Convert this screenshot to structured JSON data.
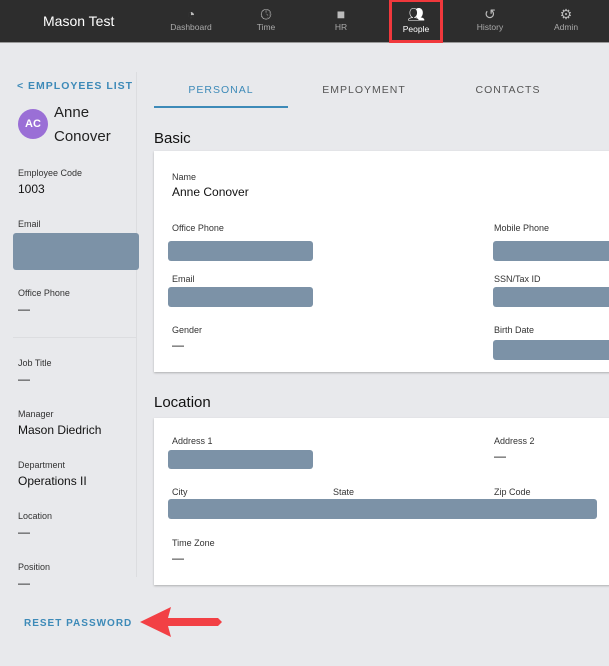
{
  "header": {
    "brand": "Mason Test",
    "nav": [
      {
        "label": "Dashboard",
        "icon": "dashboard-icon"
      },
      {
        "label": "Time",
        "icon": "clock-icon"
      },
      {
        "label": "HR",
        "icon": "folder-icon"
      },
      {
        "label": "People",
        "icon": "people-icon",
        "active": true
      },
      {
        "label": "History",
        "icon": "history-icon"
      },
      {
        "label": "Admin",
        "icon": "gear-icon"
      }
    ]
  },
  "sidebar": {
    "back": "< EMPLOYEES LIST",
    "initials": "AC",
    "first": "Anne",
    "last": "Conover",
    "employee_code_label": "Employee Code",
    "employee_code": "1003",
    "email_label": "Email",
    "office_phone_label": "Office Phone",
    "office_phone": "—",
    "job_title_label": "Job Title",
    "job_title": "—",
    "manager_label": "Manager",
    "manager": "Mason Diedrich",
    "department_label": "Department",
    "department": "Operations II",
    "location_label": "Location",
    "location": "—",
    "position_label": "Position",
    "position": "—",
    "reset": "RESET PASSWORD"
  },
  "tabs": [
    "PERSONAL",
    "EMPLOYMENT",
    "CONTACTS"
  ],
  "basic": {
    "title": "Basic",
    "name_label": "Name",
    "name": "Anne Conover",
    "office_phone_label": "Office Phone",
    "mobile_phone_label": "Mobile Phone",
    "email_label": "Email",
    "ssn_label": "SSN/Tax ID",
    "gender_label": "Gender",
    "gender": "—",
    "birth_label": "Birth Date"
  },
  "location": {
    "title": "Location",
    "address1_label": "Address 1",
    "address2_label": "Address 2",
    "address2": "—",
    "city_label": "City",
    "state_label": "State",
    "zip_label": "Zip Code",
    "tz_label": "Time Zone",
    "tz": "—"
  },
  "colors": {
    "accent": "#3d8ab8",
    "highlight": "#f0383c",
    "redaction": "#7c92a7"
  }
}
